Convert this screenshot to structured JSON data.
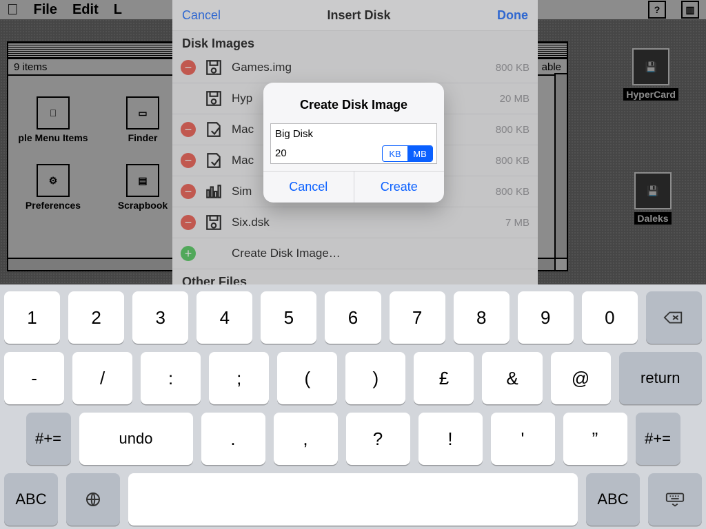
{
  "mac": {
    "menus": [
      "File",
      "Edit",
      "L"
    ],
    "window_title": "",
    "items_label": "9 items",
    "disk_available": "able",
    "icons": {
      "apple_menu": "ple Menu Items",
      "finder": "Finder",
      "preferences": "Preferences",
      "scrapbook": "Scrapbook "
    },
    "desk": {
      "hypercard": "HyperCard",
      "daleks": "Daleks"
    }
  },
  "sheet": {
    "cancel": "Cancel",
    "title": "Insert Disk",
    "done": "Done",
    "section_disk_images": "Disk Images",
    "section_other": "Other Files",
    "create_row": "Create Disk Image…",
    "rows": [
      {
        "name": "Games.img",
        "size": "800 KB"
      },
      {
        "name": "Hyp",
        "size": "20 MB"
      },
      {
        "name": "Mac",
        "size": "800 KB"
      },
      {
        "name": "Mac",
        "size": "800 KB"
      },
      {
        "name": "Sim",
        "size": "800 KB"
      },
      {
        "name": "Six.dsk",
        "size": "7 MB"
      }
    ]
  },
  "alert": {
    "title": "Create Disk Image",
    "name_value": "Big Disk",
    "size_value": "20",
    "unit_kb": "KB",
    "unit_mb": "MB",
    "selected_unit": "MB",
    "cancel": "Cancel",
    "create": "Create"
  },
  "keyboard": {
    "row1": [
      "1",
      "2",
      "3",
      "4",
      "5",
      "6",
      "7",
      "8",
      "9",
      "0"
    ],
    "row2": [
      "-",
      "/",
      ":",
      ";",
      "(",
      ")",
      "£",
      "&",
      "@"
    ],
    "row2_return": "return",
    "row3_edge": "#+=",
    "row3_undo": "undo",
    "row3": [
      ".",
      ",",
      "?",
      "!",
      "'",
      "”"
    ],
    "row3_edge2": "#+=",
    "row4_abc": "ABC"
  }
}
